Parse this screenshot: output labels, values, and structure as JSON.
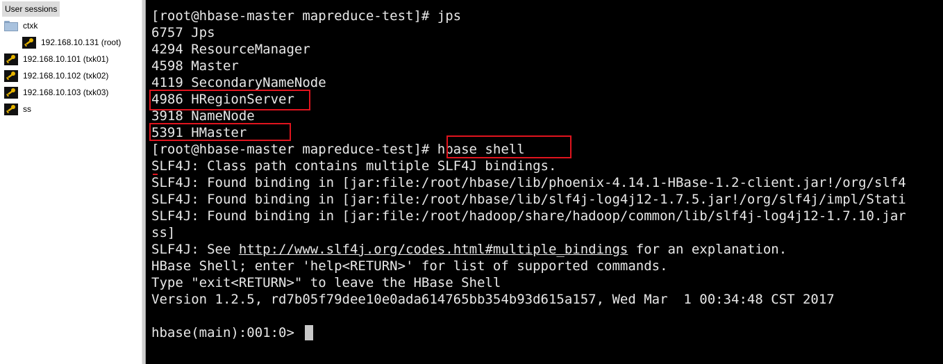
{
  "sidebar": {
    "header": "User sessions",
    "items": [
      {
        "label": "ctxk",
        "icon": "folder-icon",
        "level": 0
      },
      {
        "label": "192.168.10.131 (root)",
        "icon": "key-icon",
        "level": 1
      },
      {
        "label": "192.168.10.101 (txk01)",
        "icon": "key-icon",
        "level": 0
      },
      {
        "label": "192.168.10.102 (txk02)",
        "icon": "key-icon",
        "level": 0
      },
      {
        "label": "192.168.10.103 (txk03)",
        "icon": "key-icon",
        "level": 0
      },
      {
        "label": "ss",
        "icon": "key-icon",
        "level": 0
      }
    ]
  },
  "terminal": {
    "lines": [
      "[root@hbase-master mapreduce-test]# jps",
      "6757 Jps",
      "4294 ResourceManager",
      "4598 Master",
      "4119 SecondaryNameNode",
      "4986 HRegionServer",
      "3918 NameNode",
      "5391 HMaster",
      "[root@hbase-master mapreduce-test]# hbase shell",
      "SLF4J: Class path contains multiple SLF4J bindings.",
      "SLF4J: Found binding in [jar:file:/root/hbase/lib/phoenix-4.14.1-HBase-1.2-client.jar!/org/slf4",
      "SLF4J: Found binding in [jar:file:/root/hbase/lib/slf4j-log4j12-1.7.5.jar!/org/slf4j/impl/Stati",
      "SLF4J: Found binding in [jar:file:/root/hadoop/share/hadoop/common/lib/slf4j-log4j12-1.7.10.jar",
      "ss]",
      "SLF4J: See http://www.slf4j.org/codes.html#multiple_bindings for an explanation.",
      "HBase Shell; enter 'help<RETURN>' for list of supported commands.",
      "Type \"exit<RETURN>\" to leave the HBase Shell",
      "Version 1.2.5, rd7b05f79dee10e0ada614765bb354b93d615a157, Wed Mar  1 00:34:48 CST 2017",
      "",
      "hbase(main):001:0> "
    ],
    "link": {
      "prefix": "SLF4J: See ",
      "text": "http://www.slf4j.org/codes.html#multiple_bindings",
      "suffix": " for an explanation."
    }
  },
  "colors": {
    "terminal_bg": "#000000",
    "terminal_fg": "#e8e8e8",
    "highlight": "#e0141e"
  }
}
